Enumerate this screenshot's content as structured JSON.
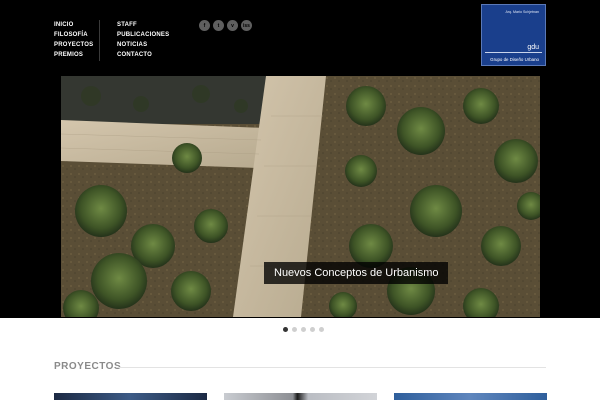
{
  "nav": {
    "col1": [
      "INICIO",
      "FILOSOFÍA",
      "PROYECTOS",
      "PREMIOS"
    ],
    "col2": [
      "STAFF",
      "PUBLICACIONES",
      "NOTICIAS",
      "CONTACTO"
    ]
  },
  "social": [
    {
      "icon": "facebook-icon",
      "glyph": "f"
    },
    {
      "icon": "twitter-icon",
      "glyph": "t"
    },
    {
      "icon": "vimeo-icon",
      "glyph": "v"
    },
    {
      "icon": "issuu-icon",
      "glyph": "iss"
    }
  ],
  "logo": {
    "author": "Arq. Mario Schjetnan",
    "mark": "gdu",
    "org": "Grupo de Diseño Urbano",
    "color": "#1a3f8c"
  },
  "hero": {
    "caption": "Nuevos Conceptos de Urbanismo"
  },
  "slider": {
    "count": 5,
    "active": 1
  },
  "projects": {
    "title": "PROYECTOS"
  }
}
